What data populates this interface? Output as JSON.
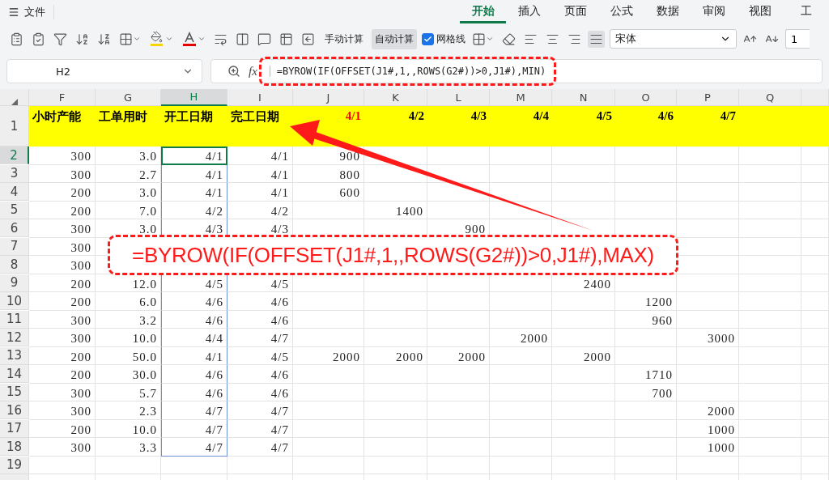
{
  "menu": {
    "file": "文件",
    "tabs": [
      {
        "label": "开始",
        "selected": true
      },
      {
        "label": "插入",
        "selected": false
      },
      {
        "label": "页面",
        "selected": false
      },
      {
        "label": "公式",
        "selected": false
      },
      {
        "label": "数据",
        "selected": false
      },
      {
        "label": "审阅",
        "selected": false
      },
      {
        "label": "视图",
        "selected": false
      },
      {
        "label": "工",
        "selected": false
      }
    ]
  },
  "toolbar": {
    "calc_buttons": [
      {
        "label": "手动计算",
        "pressed": false
      },
      {
        "label": "自动计算",
        "pressed": true
      }
    ],
    "gridlines": {
      "label": "网格线",
      "checked": true
    },
    "font": "宋体",
    "font_size": "1"
  },
  "formula_bar": {
    "name_box": "H2",
    "fx_label": "fx",
    "formula": "=BYROW(IF(OFFSET(J1#,1,,ROWS(G2#))>0,J1#),MIN)"
  },
  "columns": [
    {
      "label": "F",
      "selected": false
    },
    {
      "label": "G",
      "selected": false
    },
    {
      "label": "H",
      "selected": true
    },
    {
      "label": "I",
      "selected": false
    },
    {
      "label": "J",
      "selected": false
    },
    {
      "label": "K",
      "selected": false
    },
    {
      "label": "L",
      "selected": false
    },
    {
      "label": "M",
      "selected": false
    },
    {
      "label": "N",
      "selected": false
    },
    {
      "label": "O",
      "selected": false
    },
    {
      "label": "P",
      "selected": false
    },
    {
      "label": "Q",
      "selected": false
    }
  ],
  "header_row": {
    "num": "1",
    "selected": false,
    "cells": [
      {
        "text": "小时产能",
        "highlighted": false
      },
      {
        "text": "工单用时",
        "highlighted": false
      },
      {
        "text": "开工日期",
        "highlighted": false
      },
      {
        "text": "完工日期",
        "highlighted": false
      },
      {
        "text": "4/1",
        "highlighted": true
      },
      {
        "text": "4/2",
        "highlighted": false
      },
      {
        "text": "4/3",
        "highlighted": false
      },
      {
        "text": "4/4",
        "highlighted": false
      },
      {
        "text": "4/5",
        "highlighted": false
      },
      {
        "text": "4/6",
        "highlighted": false
      },
      {
        "text": "4/7",
        "highlighted": false
      },
      null
    ]
  },
  "rows": [
    {
      "num": "2",
      "selected": true,
      "cells": [
        "300",
        "3.0",
        "4/1",
        "4/1",
        "900",
        null,
        null,
        null,
        null,
        null,
        null,
        null
      ]
    },
    {
      "num": "3",
      "selected": false,
      "cells": [
        "300",
        "2.7",
        "4/1",
        "4/1",
        "800",
        null,
        null,
        null,
        null,
        null,
        null,
        null
      ]
    },
    {
      "num": "4",
      "selected": false,
      "cells": [
        "200",
        "3.0",
        "4/1",
        "4/1",
        "600",
        null,
        null,
        null,
        null,
        null,
        null,
        null
      ]
    },
    {
      "num": "5",
      "selected": false,
      "cells": [
        "200",
        "7.0",
        "4/2",
        "4/2",
        null,
        "1400",
        null,
        null,
        null,
        null,
        null,
        null
      ]
    },
    {
      "num": "6",
      "selected": false,
      "cells": [
        "300",
        "3.0",
        "4/3",
        "4/3",
        null,
        null,
        "900",
        null,
        null,
        null,
        null,
        null
      ]
    },
    {
      "num": "7",
      "selected": false,
      "cells": [
        "300",
        null,
        null,
        null,
        null,
        null,
        null,
        null,
        null,
        null,
        null,
        null
      ]
    },
    {
      "num": "8",
      "selected": false,
      "cells": [
        "300",
        null,
        null,
        null,
        null,
        null,
        null,
        null,
        null,
        null,
        null,
        null
      ]
    },
    {
      "num": "9",
      "selected": false,
      "cells": [
        "200",
        "12.0",
        "4/5",
        "4/5",
        null,
        null,
        null,
        null,
        "2400",
        null,
        null,
        null
      ]
    },
    {
      "num": "10",
      "selected": false,
      "cells": [
        "200",
        "6.0",
        "4/6",
        "4/6",
        null,
        null,
        null,
        null,
        null,
        "1200",
        null,
        null
      ]
    },
    {
      "num": "11",
      "selected": false,
      "cells": [
        "300",
        "3.2",
        "4/6",
        "4/6",
        null,
        null,
        null,
        null,
        null,
        "960",
        null,
        null
      ]
    },
    {
      "num": "12",
      "selected": false,
      "cells": [
        "300",
        "10.0",
        "4/4",
        "4/7",
        null,
        null,
        null,
        "2000",
        null,
        null,
        "3000",
        null
      ]
    },
    {
      "num": "13",
      "selected": false,
      "cells": [
        "200",
        "50.0",
        "4/1",
        "4/5",
        "2000",
        "2000",
        "2000",
        null,
        "2000",
        null,
        null,
        null
      ]
    },
    {
      "num": "14",
      "selected": false,
      "cells": [
        "200",
        "30.0",
        "4/6",
        "4/6",
        null,
        null,
        null,
        null,
        null,
        "1710",
        null,
        null
      ]
    },
    {
      "num": "15",
      "selected": false,
      "cells": [
        "300",
        "5.7",
        "4/6",
        "4/6",
        null,
        null,
        null,
        null,
        null,
        "700",
        null,
        null
      ]
    },
    {
      "num": "16",
      "selected": false,
      "cells": [
        "300",
        "2.3",
        "4/7",
        "4/7",
        null,
        null,
        null,
        null,
        null,
        null,
        "2000",
        null
      ]
    },
    {
      "num": "17",
      "selected": false,
      "cells": [
        "200",
        "10.0",
        "4/7",
        "4/7",
        null,
        null,
        null,
        null,
        null,
        null,
        "1000",
        null
      ]
    },
    {
      "num": "18",
      "selected": false,
      "cells": [
        "300",
        "3.3",
        "4/7",
        "4/7",
        null,
        null,
        null,
        null,
        null,
        null,
        "1000",
        null
      ]
    },
    {
      "num": "19",
      "selected": false,
      "cells": [
        null,
        null,
        null,
        null,
        null,
        null,
        null,
        null,
        null,
        null,
        null,
        null
      ]
    },
    {
      "selected": false,
      "cells": [
        null,
        null,
        null,
        null,
        null,
        null,
        null,
        null,
        null,
        null,
        null,
        null
      ]
    }
  ],
  "callout": {
    "formula": "=BYROW(IF(OFFSET(J1#,1,,ROWS(G2#))>0,J1#),MAX)"
  }
}
